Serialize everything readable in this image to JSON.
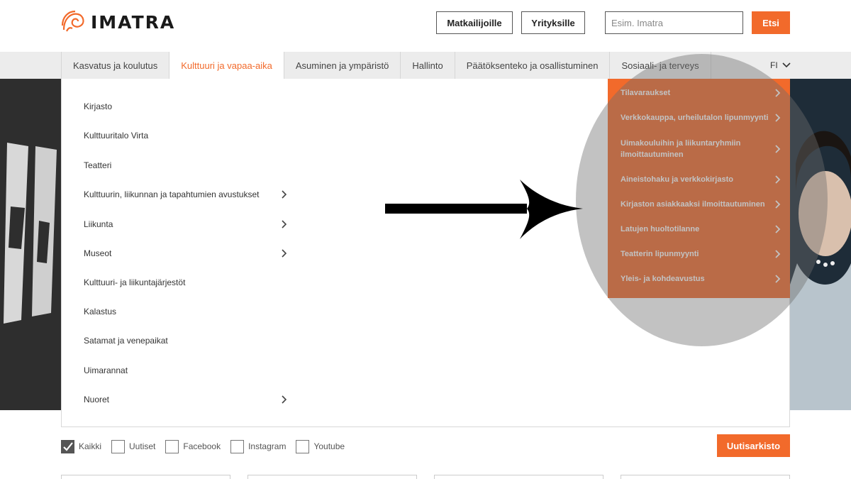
{
  "header": {
    "logo_text": "IMATRA",
    "buttons": [
      "Matkailijoille",
      "Yrityksille"
    ],
    "search_placeholder": "Esim. Imatra",
    "search_button": "Etsi"
  },
  "nav": {
    "tabs": [
      "Kasvatus ja koulutus",
      "Kulttuuri ja vapaa-aika",
      "Asuminen ja ympäristö",
      "Hallinto",
      "Päätöksenteko ja osallistuminen",
      "Sosiaali- ja terveys"
    ],
    "active_tab": "Kulttuuri ja vapaa-aika",
    "language": "FI"
  },
  "dropdown": {
    "items": [
      {
        "label": "Kirjasto",
        "has_submenu": false
      },
      {
        "label": "Kulttuuritalo Virta",
        "has_submenu": false
      },
      {
        "label": "Teatteri",
        "has_submenu": false
      },
      {
        "label": "Kulttuurin, liikunnan ja tapahtumien avustukset",
        "has_submenu": true
      },
      {
        "label": "Liikunta",
        "has_submenu": true
      },
      {
        "label": "Museot",
        "has_submenu": true
      },
      {
        "label": "Kulttuuri- ja liikuntajärjestöt",
        "has_submenu": false
      },
      {
        "label": "Kalastus",
        "has_submenu": false
      },
      {
        "label": "Satamat ja venepaikat",
        "has_submenu": false
      },
      {
        "label": "Uimarannat",
        "has_submenu": false
      },
      {
        "label": "Nuoret",
        "has_submenu": true
      }
    ]
  },
  "quick_links": [
    "Tilavaraukset",
    "Verkkokauppa, urheilutalon lipunmyynti",
    "Uimakouluihin ja liikuntaryhmiin ilmoittautuminen",
    "Aineistohaku ja verkkokirjasto",
    "Kirjaston asiakkaaksi ilmoittautuminen",
    "Latujen huoltotilanne",
    "Teatterin lipunmyynti",
    "Yleis- ja kohdeavustus"
  ],
  "filters": {
    "options": [
      {
        "label": "Kaikki",
        "checked": true
      },
      {
        "label": "Uutiset",
        "checked": false
      },
      {
        "label": "Facebook",
        "checked": false
      },
      {
        "label": "Instagram",
        "checked": false
      },
      {
        "label": "Youtube",
        "checked": false
      }
    ],
    "archive_button": "Uutisarkisto"
  },
  "colors": {
    "accent": "#f26a2b",
    "nav_bg": "#ececec",
    "text": "#333333"
  },
  "icons": [
    "logo-swirl-icon",
    "chevron-down-icon",
    "chevron-right-icon",
    "checkmark-icon",
    "arrow-right-icon"
  ]
}
